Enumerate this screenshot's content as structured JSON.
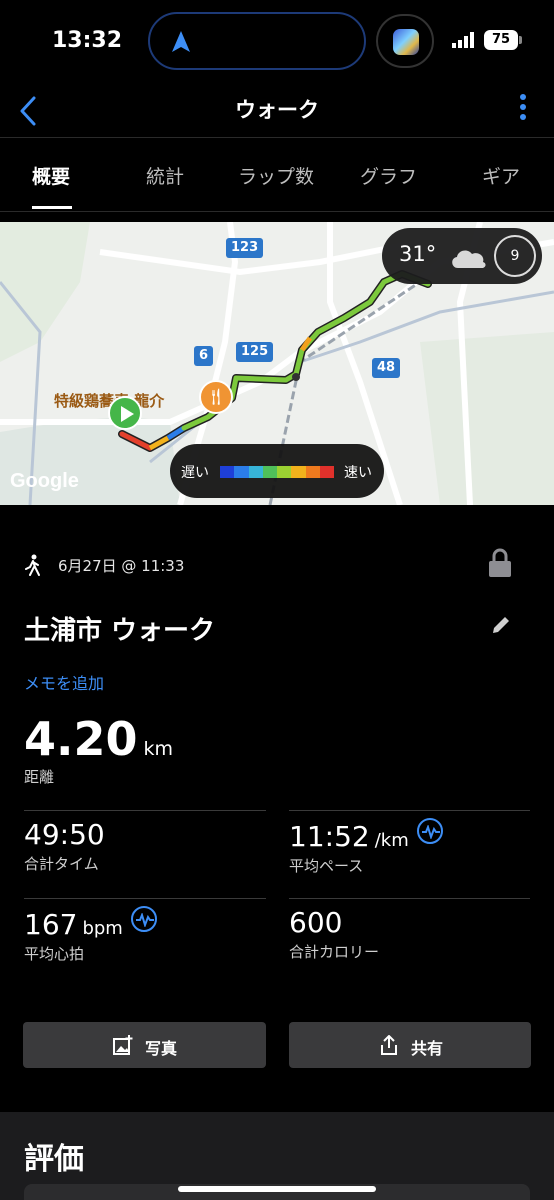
{
  "status_bar": {
    "time": "13:32",
    "battery": "75"
  },
  "header": {
    "title": "ウォーク"
  },
  "tabs": [
    {
      "label": "概要"
    },
    {
      "label": "統計"
    },
    {
      "label": "ラップ数"
    },
    {
      "label": "グラフ"
    },
    {
      "label": "ギア"
    }
  ],
  "map": {
    "road_numbers": [
      "123",
      "6",
      "125",
      "48"
    ],
    "place_label": "特級鶏蕎麦 龍介",
    "google_label": "Google",
    "weather": {
      "temperature": "31°",
      "wind": "9"
    },
    "legend": {
      "slow": "遅い",
      "fast": "速い",
      "colors": [
        "#1e3fd8",
        "#2b7de9",
        "#37b4d8",
        "#4fc05a",
        "#9bd232",
        "#f2b21c",
        "#ef7a1e",
        "#e0312b"
      ]
    }
  },
  "activity": {
    "date": "6月27日 @ 11:33",
    "name": "土浦市 ウォーク",
    "add_note": "メモを追加",
    "distance": {
      "value": "4.20",
      "unit": "km",
      "label": "距離"
    }
  },
  "stats": {
    "total_time": {
      "value": "49:50",
      "label": "合計タイム"
    },
    "avg_pace": {
      "value": "11:52",
      "unit": "/km",
      "label": "平均ペース"
    },
    "avg_hr": {
      "value": "167",
      "unit": "bpm",
      "label": "平均心拍"
    },
    "calories": {
      "value": "600",
      "label": "合計カロリー"
    }
  },
  "buttons": {
    "photo": "写真",
    "share": "共有"
  },
  "rating": {
    "title": "評価"
  },
  "accent_color": "#3d8ef6"
}
